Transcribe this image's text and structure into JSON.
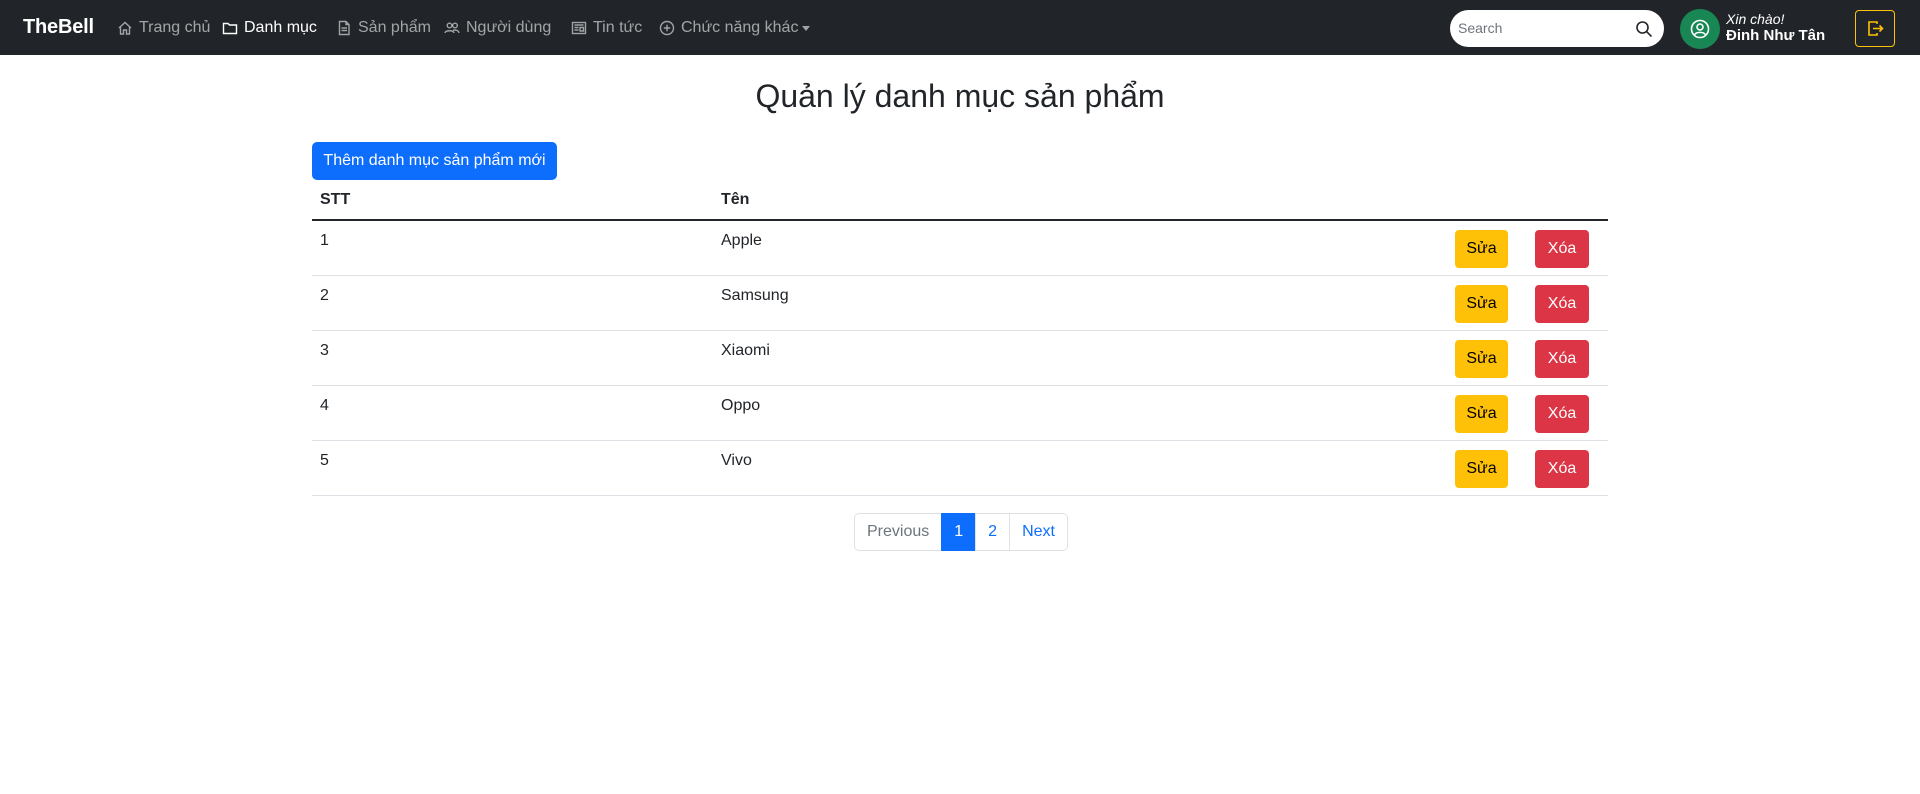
{
  "navbar": {
    "brand": "TheBell",
    "items": [
      {
        "label": "Trang chủ",
        "icon": "home-icon",
        "active": false
      },
      {
        "label": "Danh mục",
        "icon": "folder-icon",
        "active": true
      },
      {
        "label": "Sản phẩm",
        "icon": "file-icon",
        "active": false
      },
      {
        "label": "Người dùng",
        "icon": "people-icon",
        "active": false
      },
      {
        "label": "Tin tức",
        "icon": "newspaper-icon",
        "active": false
      },
      {
        "label": "Chức năng khác",
        "icon": "plus-circle-icon",
        "active": false
      }
    ],
    "search_placeholder": "Search",
    "greeting": "Xin chào!",
    "username": "Đinh Như Tân"
  },
  "main": {
    "title": "Quản lý danh mục sản phẩm",
    "add_button": "Thêm danh mục sản phẩm mới",
    "table": {
      "headers": [
        "STT",
        "Tên"
      ],
      "rows": [
        {
          "stt": "1",
          "name": "Apple"
        },
        {
          "stt": "2",
          "name": "Samsung"
        },
        {
          "stt": "3",
          "name": "Xiaomi"
        },
        {
          "stt": "4",
          "name": "Oppo"
        },
        {
          "stt": "5",
          "name": "Vivo"
        }
      ],
      "edit_label": "Sửa",
      "delete_label": "Xóa"
    },
    "pagination": {
      "previous": "Previous",
      "pages": [
        "1",
        "2"
      ],
      "current": "1",
      "next": "Next"
    }
  },
  "colors": {
    "navbar_bg": "#212529",
    "primary": "#0d6efd",
    "warning": "#ffc107",
    "danger": "#dc3545",
    "avatar": "#198754"
  }
}
